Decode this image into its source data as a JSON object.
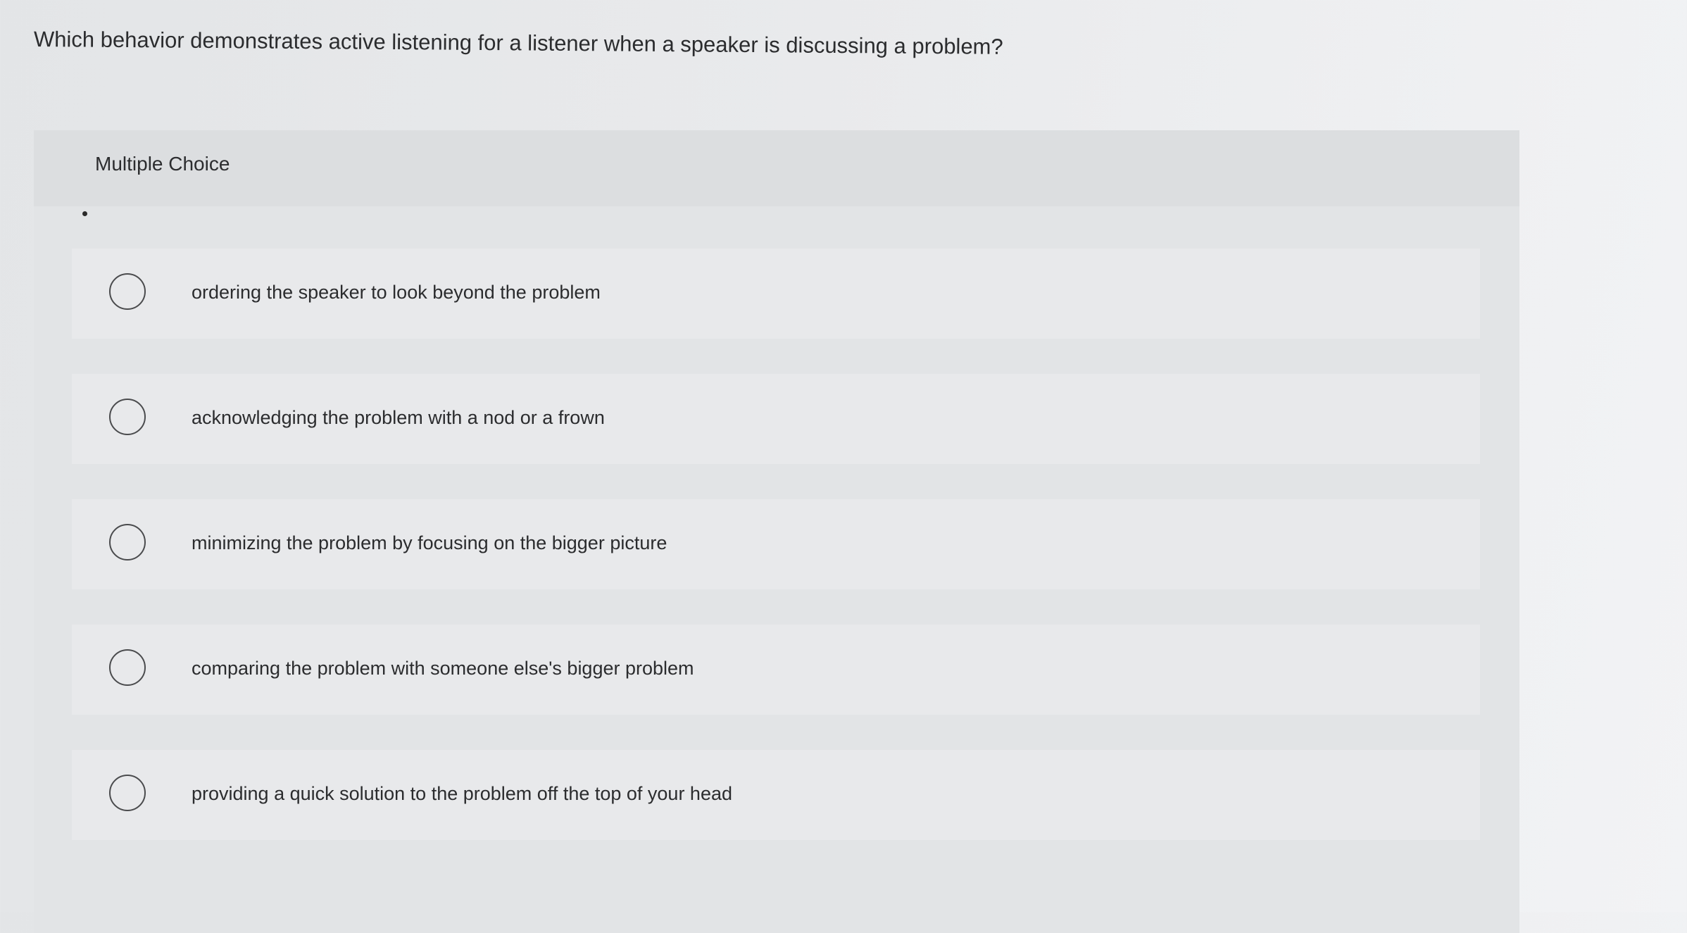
{
  "question": {
    "text": "Which behavior demonstrates active listening for a listener when a speaker is discussing a problem?"
  },
  "panel": {
    "header_label": "Multiple Choice"
  },
  "options": [
    {
      "label": "ordering the speaker to look beyond the problem",
      "selected": false
    },
    {
      "label": "acknowledging the problem with a nod or a frown",
      "selected": false
    },
    {
      "label": "minimizing the problem by focusing on the bigger picture",
      "selected": false
    },
    {
      "label": "comparing the problem with someone else's bigger problem",
      "selected": false
    },
    {
      "label": "providing a quick solution to the problem off the top of your head",
      "selected": false
    }
  ]
}
